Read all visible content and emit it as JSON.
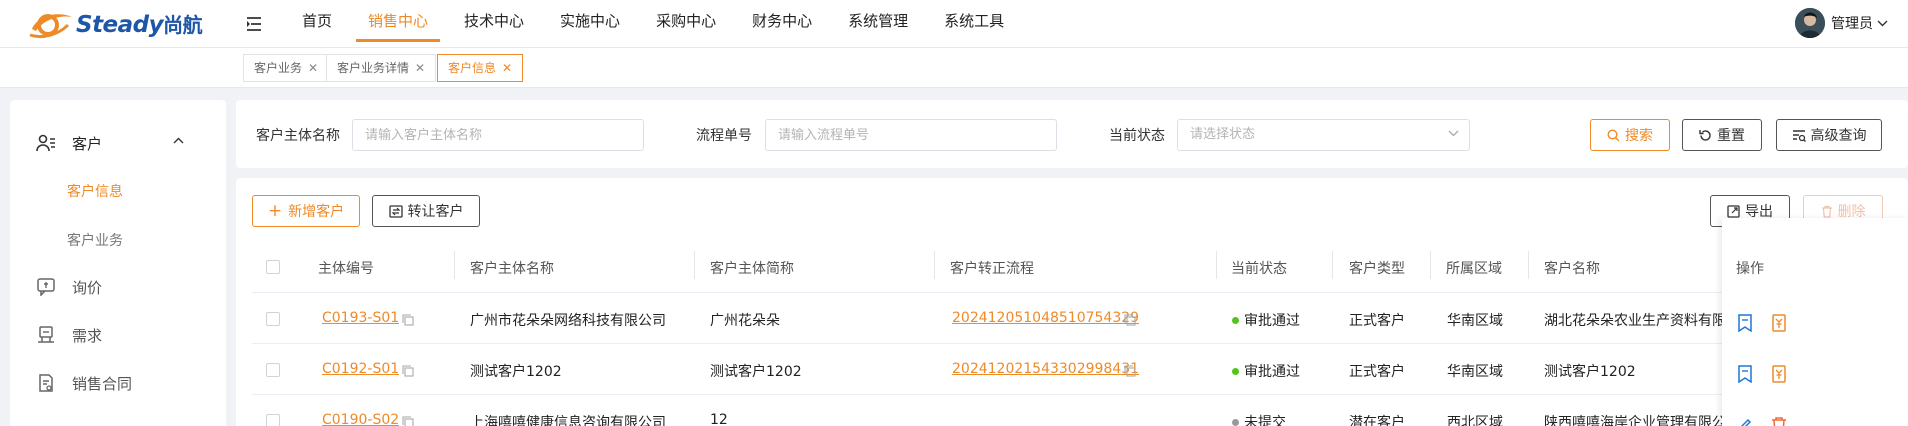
{
  "header": {
    "logo_text": "Steady",
    "logo_cn": "尚航",
    "nav": [
      "首页",
      "销售中心",
      "技术中心",
      "实施中心",
      "采购中心",
      "财务中心",
      "系统管理",
      "系统工具"
    ],
    "active_nav": 1,
    "user_name": "管理员"
  },
  "tabs": [
    {
      "label": "客户业务",
      "active": false
    },
    {
      "label": "客户业务详情",
      "active": false
    },
    {
      "label": "客户信息",
      "active": true
    }
  ],
  "sidebar": {
    "items": [
      {
        "label": "客户",
        "icon": "customer-icon"
      },
      {
        "label": "客户信息",
        "sub": true,
        "active": true
      },
      {
        "label": "客户业务",
        "sub": true,
        "active": false
      },
      {
        "label": "询价",
        "icon": "inquiry-icon"
      },
      {
        "label": "需求",
        "icon": "demand-icon"
      },
      {
        "label": "销售合同",
        "icon": "contract-icon"
      }
    ]
  },
  "search": {
    "subject_label": "客户主体名称",
    "subject_placeholder": "请输入客户主体名称",
    "flow_label": "流程单号",
    "flow_placeholder": "请输入流程单号",
    "status_label": "当前状态",
    "status_placeholder": "请选择状态",
    "search_btn": "搜索",
    "reset_btn": "重置",
    "advanced_btn": "高级查询"
  },
  "toolbar": {
    "add_btn": "新增客户",
    "transfer_btn": "转让客户",
    "export_btn": "导出",
    "delete_btn": "删除"
  },
  "table": {
    "columns": [
      "主体编号",
      "客户主体名称",
      "客户主体简称",
      "客户转正流程",
      "当前状态",
      "客户类型",
      "所属区域",
      "客户名称",
      "操作"
    ],
    "rows": [
      {
        "id": "C0193-S01",
        "name": "广州市花朵朵网络科技有限公司",
        "short": "广州花朵朵",
        "flow": "20241205104851075432​9",
        "status": "审批通过",
        "status_color": "#52c41a",
        "type": "正式客户",
        "region": "华南区域",
        "customer": "湖北花朵朵农业生产资料有限"
      },
      {
        "id": "C0192-S01",
        "name": "测试客户1202",
        "short": "测试客户1202",
        "flow": "20241202154330299843​1",
        "status": "审批通过",
        "status_color": "#52c41a",
        "type": "正式客户",
        "region": "华南区域",
        "customer": "测试客户1202"
      },
      {
        "id": "C0190-S02",
        "name": "上海嘻嘻健康信息咨询有限公司",
        "short": "12",
        "flow": "",
        "status": "未提交",
        "status_color": "#999999",
        "type": "潜在客户",
        "region": "西北区域",
        "customer": "陕西嘻嘻海岸企业管理有限公"
      }
    ]
  },
  "colors": {
    "accent": "#ef8a28",
    "brand_blue": "#1f57a8"
  }
}
